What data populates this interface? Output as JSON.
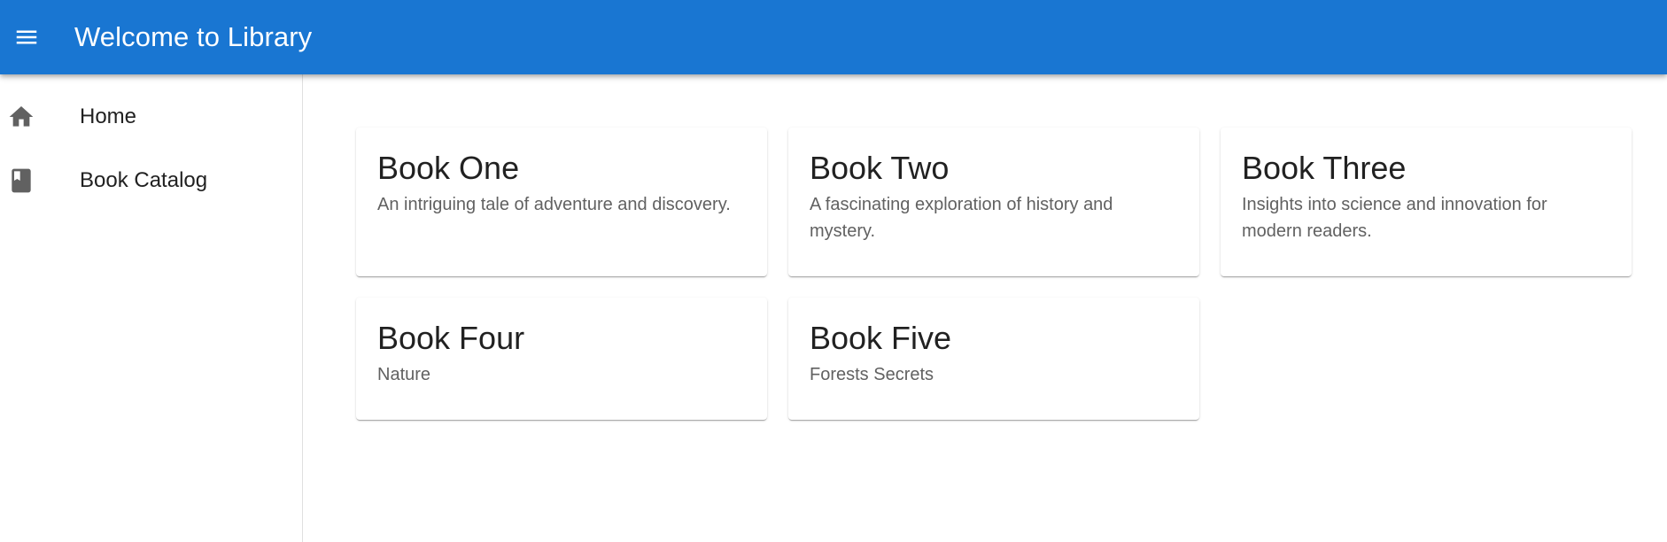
{
  "appbar": {
    "title": "Welcome to Library",
    "menu_icon": "menu-icon",
    "background": "#1976d2"
  },
  "sidebar": {
    "items": [
      {
        "label": "Home",
        "icon": "home-icon"
      },
      {
        "label": "Book Catalog",
        "icon": "book-icon"
      }
    ]
  },
  "books": [
    {
      "title": "Book One",
      "description": "An intriguing tale of adventure and discovery."
    },
    {
      "title": "Book Two",
      "description": "A fascinating exploration of history and mystery."
    },
    {
      "title": "Book Three",
      "description": "Insights into science and innovation for modern readers."
    },
    {
      "title": "Book Four",
      "description": "Nature"
    },
    {
      "title": "Book Five",
      "description": "Forests Secrets"
    }
  ]
}
